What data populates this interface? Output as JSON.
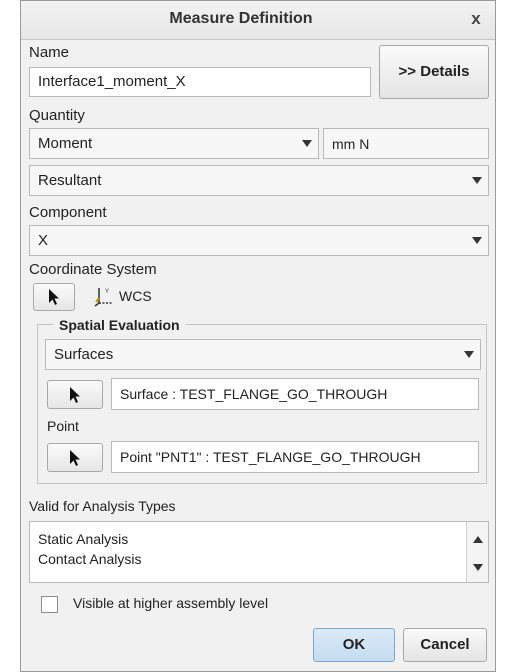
{
  "dialog": {
    "title": "Measure Definition",
    "close_label": "x"
  },
  "name": {
    "label": "Name",
    "value": "Interface1_moment_X",
    "details_button": ">> Details"
  },
  "quantity": {
    "label": "Quantity",
    "selected": "Moment",
    "units": "mm N"
  },
  "resultant": {
    "selected": "Resultant"
  },
  "component": {
    "label": "Component",
    "selected": "X"
  },
  "coordinate_system": {
    "label": "Coordinate System",
    "value": "WCS"
  },
  "spatial_evaluation": {
    "title": "Spatial Evaluation",
    "selected": "Surfaces",
    "surface_value": "Surface : TEST_FLANGE_GO_THROUGH",
    "point_label": "Point",
    "point_value": "Point \"PNT1\" : TEST_FLANGE_GO_THROUGH"
  },
  "analysis_types": {
    "label": "Valid for Analysis Types",
    "items": [
      "Static Analysis",
      "Contact Analysis"
    ]
  },
  "visible_checkbox": {
    "label": "Visible at higher assembly level",
    "checked": false
  },
  "buttons": {
    "ok": "OK",
    "cancel": "Cancel"
  },
  "colors": {
    "accent": "#cfe2f3",
    "dialog_bg": "#f1f1f1"
  },
  "icons": [
    "close-icon",
    "cursor-arrow-icon",
    "coordinate-system-icon",
    "chevron-down-icon",
    "scroll-up-icon",
    "scroll-down-icon"
  ]
}
